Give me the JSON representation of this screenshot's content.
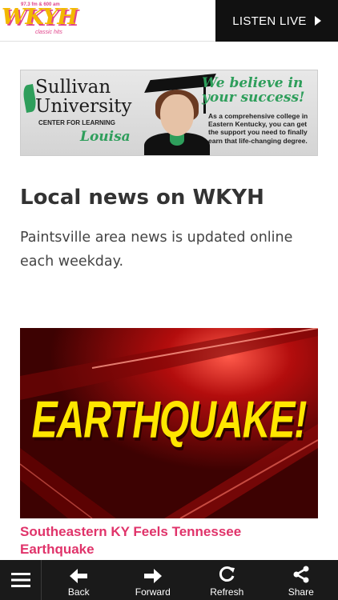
{
  "header": {
    "logo_text": "WKYH",
    "logo_frequency": "97.3 fm & 600 am",
    "logo_tagline": "classic hits",
    "listen_live_label": "LISTEN LIVE"
  },
  "ad": {
    "brand_line1": "Sullivan",
    "brand_line2": "University",
    "center_label": "CENTER FOR LEARNING",
    "town": "Louisa",
    "slogan_line1": "We believe in",
    "slogan_line2": "your success!",
    "description": "As a comprehensive college in Eastern Kentucky, you can get the support you need to finally earn that life-changing degree."
  },
  "main": {
    "title": "Local news on WKYH",
    "intro": "Paintsville area news is updated online each weekday."
  },
  "article": {
    "image_text": "EARTHQUAKE!",
    "headline": "Southeastern KY Feels Tennessee Earthquake"
  },
  "toolbar": {
    "back_label": "Back",
    "forward_label": "Forward",
    "refresh_label": "Refresh",
    "share_label": "Share"
  },
  "colors": {
    "accent_pink": "#e0336a",
    "logo_yellow": "#f3b800",
    "ad_green": "#2e9e5b",
    "toolbar_bg": "#1a1a1a"
  }
}
